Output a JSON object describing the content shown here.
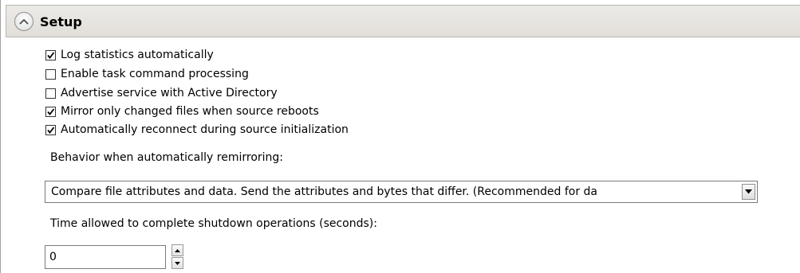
{
  "section": {
    "title": "Setup",
    "collapse_icon": "chevron-up-icon"
  },
  "options": [
    {
      "label": "Log statistics automatically",
      "checked": true
    },
    {
      "label": "Enable task command processing",
      "checked": false
    },
    {
      "label": "Advertise service with Active Directory",
      "checked": false
    },
    {
      "label": "Mirror only changed files when source reboots",
      "checked": true
    },
    {
      "label": "Automatically reconnect during source initialization",
      "checked": true
    }
  ],
  "remirror": {
    "label": "Behavior when automatically remirroring:",
    "selected": "Compare file attributes and data. Send the attributes and bytes that differ. (Recommended for da",
    "dropdown_icon": "chevron-down-icon"
  },
  "shutdown": {
    "label": "Time allowed to complete shutdown operations (seconds):",
    "value": "0",
    "up_icon": "spin-up-icon",
    "down_icon": "spin-down-icon"
  }
}
